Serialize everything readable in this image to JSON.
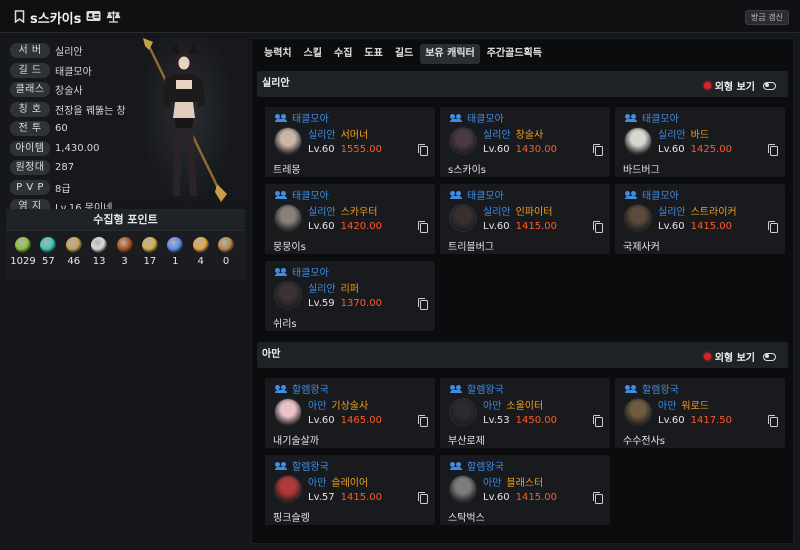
{
  "header": {
    "name": "s스카이s",
    "refresh_label": "방금 갱신"
  },
  "profile": {
    "rows": [
      {
        "key": "서 버",
        "value": "실리안"
      },
      {
        "key": "길 드",
        "value": "태클모아"
      },
      {
        "key": "클래스",
        "value": "창술사"
      },
      {
        "key": "칭 호",
        "value": "전장을 꿰뚫는 창"
      },
      {
        "key": "전 투",
        "value": "60"
      },
      {
        "key": "아이템",
        "value": "1,430.00"
      },
      {
        "key": "원정대",
        "value": "287"
      },
      {
        "key": "P V P",
        "value": "8급"
      },
      {
        "key": "영 지",
        "value": "Lv.16 몽이네"
      }
    ]
  },
  "collection": {
    "title": "수집형 포인트",
    "items": [
      {
        "icon": "mokoko-seed-icon",
        "color": "#8fc23a",
        "value": "1029"
      },
      {
        "icon": "island-heart-icon",
        "color": "#3fc7b6",
        "value": "57"
      },
      {
        "icon": "great-art-icon",
        "color": "#c9a25a",
        "value": "46"
      },
      {
        "icon": "giants-heart-icon",
        "color": "#d9d9d9",
        "value": "13"
      },
      {
        "icon": "ignea-token-icon",
        "color": "#b3541e",
        "value": "3"
      },
      {
        "icon": "sea-bounty-icon",
        "color": "#d8b04a",
        "value": "17"
      },
      {
        "icon": "world-tree-leaf-icon",
        "color": "#5a8ee8",
        "value": "1"
      },
      {
        "icon": "orpheus-star-icon",
        "color": "#e6a63a",
        "value": "4"
      },
      {
        "icon": "omnium-star-icon",
        "color": "#b58a4a",
        "value": "0"
      }
    ]
  },
  "tabs": [
    {
      "label": "능력치",
      "active": false
    },
    {
      "label": "스킬",
      "active": false
    },
    {
      "label": "수집",
      "active": false
    },
    {
      "label": "도표",
      "active": false
    },
    {
      "label": "길드",
      "active": false
    },
    {
      "label": "보유 캐릭터",
      "active": true
    },
    {
      "label": "주간골드획득",
      "active": false
    }
  ],
  "appearance_label": "외형 보기",
  "groups": [
    {
      "server": "실리안",
      "characters": [
        {
          "guild": "태클모아",
          "server": "실리안",
          "class": "서머너",
          "level": "Lv.60",
          "item_level": "1555.00",
          "name": "트레몽",
          "avatar_color": "#c9b6a8"
        },
        {
          "guild": "태클모아",
          "server": "실리안",
          "class": "창술사",
          "level": "Lv.60",
          "item_level": "1430.00",
          "name": "s스카이s",
          "avatar_color": "#4a3a44"
        },
        {
          "guild": "태클모아",
          "server": "실리안",
          "class": "바드",
          "level": "Lv.60",
          "item_level": "1425.00",
          "name": "바드버그",
          "avatar_color": "#d9d6d2"
        },
        {
          "guild": "태클모아",
          "server": "실리안",
          "class": "스카우터",
          "level": "Lv.60",
          "item_level": "1420.00",
          "name": "뭉뭉이s",
          "avatar_color": "#8a7f79"
        },
        {
          "guild": "태클모아",
          "server": "실리안",
          "class": "인파이터",
          "level": "Lv.60",
          "item_level": "1415.00",
          "name": "트리블버그",
          "avatar_color": "#3a2f2f"
        },
        {
          "guild": "태클모아",
          "server": "실리안",
          "class": "스트라이커",
          "level": "Lv.60",
          "item_level": "1415.00",
          "name": "국제사커",
          "avatar_color": "#5c4a3e"
        },
        {
          "guild": "태클모아",
          "server": "실리안",
          "class": "리퍼",
          "level": "Lv.59",
          "item_level": "1370.00",
          "name": "쉬리s",
          "avatar_color": "#3b3236"
        }
      ]
    },
    {
      "server": "아만",
      "characters": [
        {
          "guild": "할렘왕국",
          "server": "아만",
          "class": "기상술사",
          "level": "Lv.60",
          "item_level": "1465.00",
          "name": "내기술살까",
          "avatar_color": "#e9c2c9"
        },
        {
          "guild": "할렘왕국",
          "server": "아만",
          "class": "소울이터",
          "level": "Lv.53",
          "item_level": "1450.00",
          "name": "부산로제",
          "avatar_color": "#2d2a30"
        },
        {
          "guild": "할렘왕국",
          "server": "아만",
          "class": "워로드",
          "level": "Lv.60",
          "item_level": "1417.50",
          "name": "수수전사s",
          "avatar_color": "#6e5d40"
        },
        {
          "guild": "할렘왕국",
          "server": "아만",
          "class": "슬레이어",
          "level": "Lv.57",
          "item_level": "1415.00",
          "name": "핑크슬렝",
          "avatar_color": "#b23a3a"
        },
        {
          "guild": "할렘왕국",
          "server": "아만",
          "class": "블래스터",
          "level": "Lv.60",
          "item_level": "1415.00",
          "name": "스탁벅스",
          "avatar_color": "#7d7d7d"
        }
      ]
    }
  ]
}
